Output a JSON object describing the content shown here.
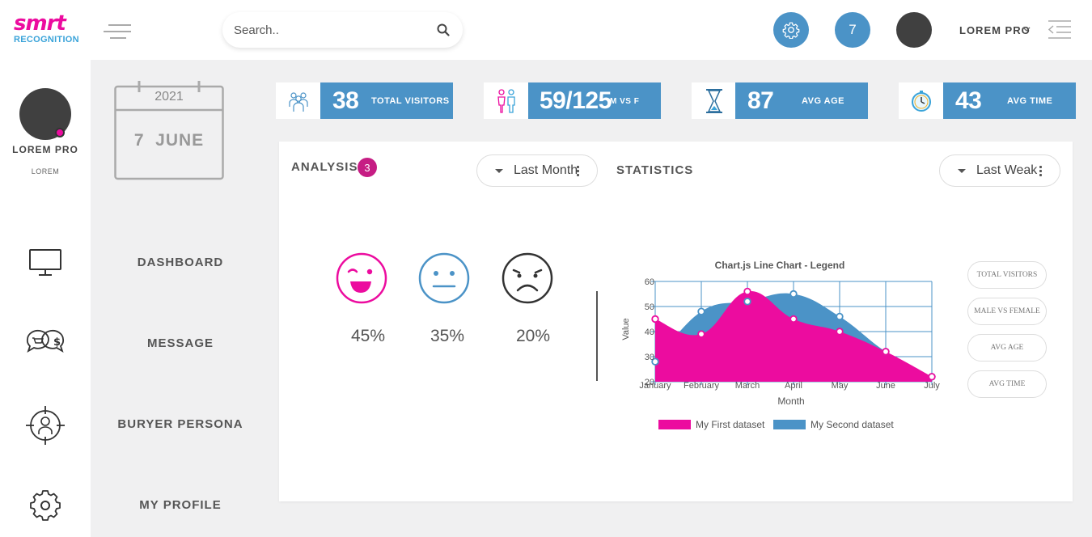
{
  "brand": {
    "logo_top": "smrt",
    "logo_bottom": "RECOGNITION",
    "pink": "#ec0c9f",
    "blue": "#3aa3d9"
  },
  "search": {
    "placeholder": "Search.."
  },
  "header": {
    "notification_count": "7",
    "user_name": "LOREM PRO"
  },
  "sidebar": {
    "name": "LOREM PRO",
    "role": "LOREM"
  },
  "calendar": {
    "year": "2021",
    "date": "7  JUNE"
  },
  "nav": [
    "DASHBOARD",
    "MESSAGE",
    "BURYER PERSONA",
    "MY PROFILE"
  ],
  "stats": [
    {
      "value": "38",
      "label": "TOTAL VISITORS",
      "icon": "people-icon"
    },
    {
      "value": "59/125",
      "label": "M VS F",
      "icon": "male-female-icon"
    },
    {
      "value": "87",
      "label": "AVG AGE",
      "icon": "hourglass-icon"
    },
    {
      "value": "43",
      "label": "AVG TIME",
      "icon": "clock-icon"
    }
  ],
  "analysis": {
    "title": "ANALYSIS",
    "badge": "3",
    "dropdown": "Last Month",
    "moods": [
      {
        "icon": "happy-face-icon",
        "pct": "45%"
      },
      {
        "icon": "neutral-face-icon",
        "pct": "35%"
      },
      {
        "icon": "sad-face-icon",
        "pct": "20%"
      }
    ]
  },
  "statistics": {
    "title": "STATISTICS",
    "dropdown": "Last Weak",
    "pills": [
      "TOTAL VISITORS",
      "MALE VS FEMALE",
      "AVG AGE",
      "AVG TIME"
    ]
  },
  "chart_data": {
    "type": "area",
    "title": "Chart.js Line Chart - Legend",
    "xlabel": "Month",
    "ylabel": "Value",
    "categories": [
      "January",
      "February",
      "March",
      "April",
      "May",
      "June",
      "July"
    ],
    "ylim": [
      20,
      60
    ],
    "yticks": [
      20,
      30,
      40,
      50,
      60
    ],
    "legend_position": "bottom",
    "series": [
      {
        "name": "My First dataset",
        "values": [
          45,
          39,
          56,
          45,
          40,
          32,
          22
        ],
        "color": "#ec0c9f"
      },
      {
        "name": "My Second dataset",
        "values": [
          28,
          48,
          52,
          55,
          46,
          32,
          22
        ],
        "color": "#4b93c7"
      }
    ]
  }
}
